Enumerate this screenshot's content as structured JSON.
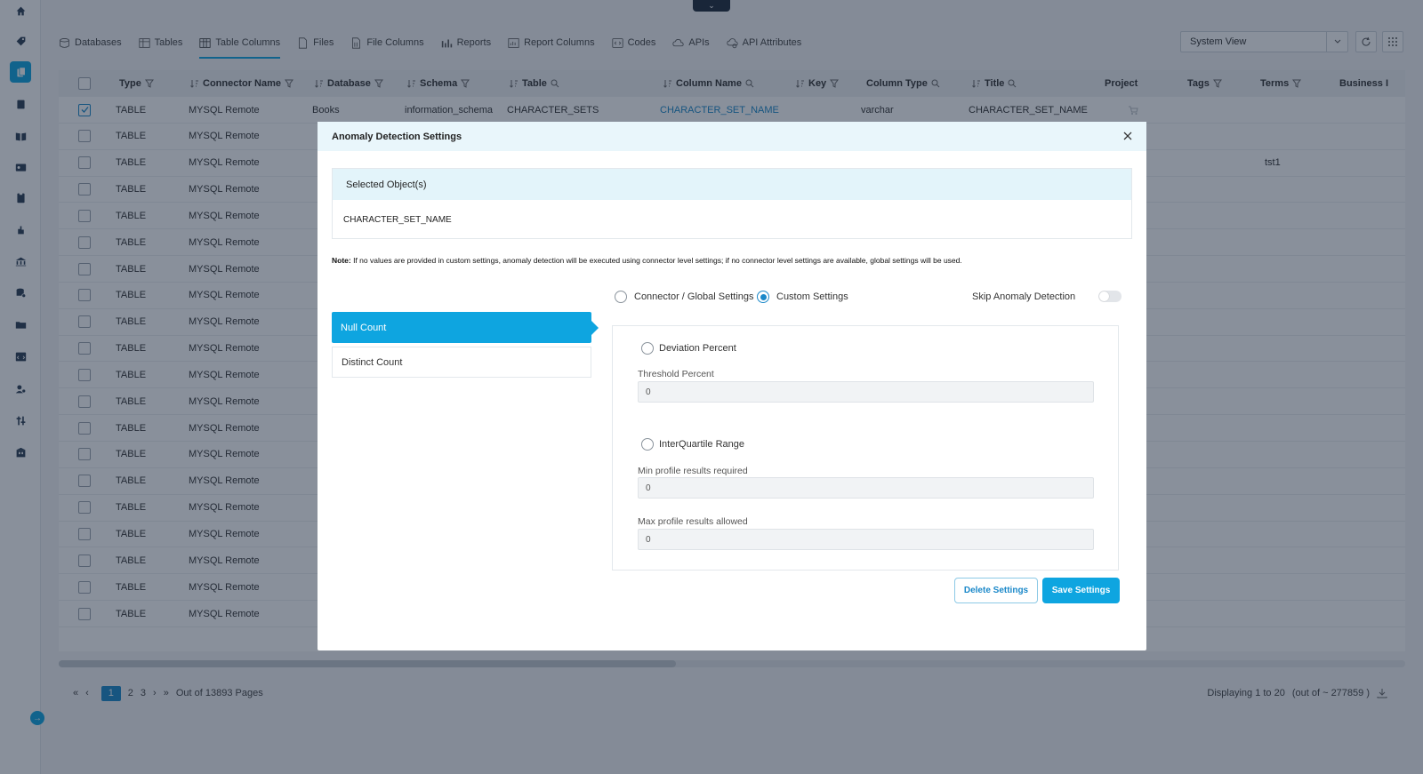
{
  "tabs": [
    {
      "label": "Databases",
      "icon": "database-icon"
    },
    {
      "label": "Tables",
      "icon": "table-icon"
    },
    {
      "label": "Table Columns",
      "icon": "table-columns-icon",
      "active": true
    },
    {
      "label": "Files",
      "icon": "file-icon"
    },
    {
      "label": "File Columns",
      "icon": "file-columns-icon"
    },
    {
      "label": "Reports",
      "icon": "report-icon"
    },
    {
      "label": "Report Columns",
      "icon": "report-columns-icon"
    },
    {
      "label": "Codes",
      "icon": "code-icon"
    },
    {
      "label": "APIs",
      "icon": "api-icon"
    },
    {
      "label": "API Attributes",
      "icon": "api-attributes-icon"
    }
  ],
  "view_select": {
    "value": "System View"
  },
  "table": {
    "headers": [
      "Type",
      "Connector Name",
      "Database",
      "Schema",
      "Table",
      "Column Name",
      "Key",
      "Column Type",
      "Title",
      "Project",
      "Tags",
      "Terms",
      "Business I"
    ],
    "first_row": {
      "type": "TABLE",
      "connector": "MYSQL Remote",
      "database": "Books",
      "schema": "information_schema",
      "table": "CHARACTER_SETS",
      "column": "CHARACTER_SET_NAME",
      "column_type": "varchar",
      "title": "CHARACTER_SET_NAME"
    },
    "row_type": "TABLE",
    "row_connector": "MYSQL Remote",
    "third_row_terms": "tst1"
  },
  "pager": {
    "pages": [
      "1",
      "2",
      "3"
    ],
    "out_of": "Out of 13893 Pages",
    "displaying": "Displaying 1 to 20",
    "total": "(out of ~ 277859 )"
  },
  "modal": {
    "title": "Anomaly Detection Settings",
    "selected_header": "Selected Object(s)",
    "selected_value": "CHARACTER_SET_NAME",
    "note_bold": "Note:",
    "note_text": " If no values are provided in custom settings, anomaly detection will be executed using connector level settings; if no connector level settings are available, global settings will be used.",
    "radio_connector": "Connector / Global Settings",
    "radio_custom": "Custom Settings",
    "skip_label": "Skip Anomaly Detection",
    "side_items": [
      "Null Count",
      "Distinct Count"
    ],
    "deviation_label": "Deviation Percent",
    "threshold_label": "Threshold Percent",
    "threshold_value": "0",
    "iqr_label": "InterQuartile Range",
    "min_label": "Min profile results required",
    "min_value": "0",
    "max_label": "Max profile results allowed",
    "max_value": "0",
    "delete_button": "Delete Settings",
    "save_button": "Save Settings"
  },
  "colors": {
    "accent": "#0ea5e0",
    "link": "#1a88c9",
    "overlay": "#142137"
  }
}
